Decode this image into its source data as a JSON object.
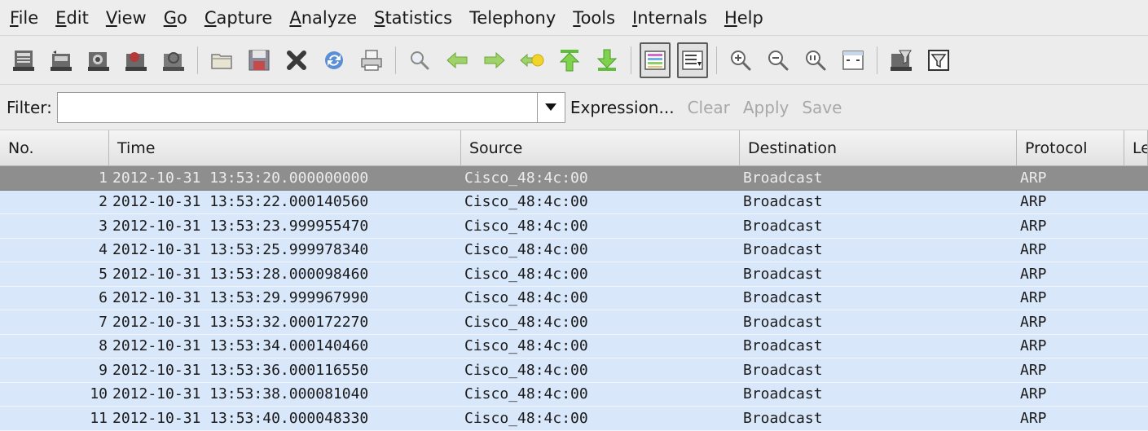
{
  "menu": [
    {
      "acc": "F",
      "rest": "ile"
    },
    {
      "acc": "E",
      "rest": "dit"
    },
    {
      "acc": "V",
      "rest": "iew"
    },
    {
      "acc": "G",
      "rest": "o"
    },
    {
      "acc": "C",
      "rest": "apture"
    },
    {
      "acc": "A",
      "rest": "nalyze"
    },
    {
      "acc": "S",
      "rest": "tatistics"
    },
    {
      "acc": "",
      "rest": "Telephony"
    },
    {
      "acc": "T",
      "rest": "ools"
    },
    {
      "acc": "I",
      "rest": "nternals"
    },
    {
      "acc": "H",
      "rest": "elp"
    }
  ],
  "filter": {
    "label": "Filter:",
    "value": "",
    "expression_label": "Expression...",
    "clear_label": "Clear",
    "apply_label": "Apply",
    "save_label": "Save"
  },
  "columns": {
    "no": "No.",
    "time": "Time",
    "source": "Source",
    "destination": "Destination",
    "protocol": "Protocol",
    "length": "Le"
  },
  "packets": [
    {
      "no": "1",
      "time": "2012-10-31  13:53:20.000000000",
      "source": "Cisco_48:4c:00",
      "destination": "Broadcast",
      "protocol": "ARP"
    },
    {
      "no": "2",
      "time": "2012-10-31  13:53:22.000140560",
      "source": "Cisco_48:4c:00",
      "destination": "Broadcast",
      "protocol": "ARP"
    },
    {
      "no": "3",
      "time": "2012-10-31  13:53:23.999955470",
      "source": "Cisco_48:4c:00",
      "destination": "Broadcast",
      "protocol": "ARP"
    },
    {
      "no": "4",
      "time": "2012-10-31  13:53:25.999978340",
      "source": "Cisco_48:4c:00",
      "destination": "Broadcast",
      "protocol": "ARP"
    },
    {
      "no": "5",
      "time": "2012-10-31  13:53:28.000098460",
      "source": "Cisco_48:4c:00",
      "destination": "Broadcast",
      "protocol": "ARP"
    },
    {
      "no": "6",
      "time": "2012-10-31  13:53:29.999967990",
      "source": "Cisco_48:4c:00",
      "destination": "Broadcast",
      "protocol": "ARP"
    },
    {
      "no": "7",
      "time": "2012-10-31  13:53:32.000172270",
      "source": "Cisco_48:4c:00",
      "destination": "Broadcast",
      "protocol": "ARP"
    },
    {
      "no": "8",
      "time": "2012-10-31  13:53:34.000140460",
      "source": "Cisco_48:4c:00",
      "destination": "Broadcast",
      "protocol": "ARP"
    },
    {
      "no": "9",
      "time": "2012-10-31  13:53:36.000116550",
      "source": "Cisco_48:4c:00",
      "destination": "Broadcast",
      "protocol": "ARP"
    },
    {
      "no": "10",
      "time": "2012-10-31  13:53:38.000081040",
      "source": "Cisco_48:4c:00",
      "destination": "Broadcast",
      "protocol": "ARP"
    },
    {
      "no": "11",
      "time": "2012-10-31  13:53:40.000048330",
      "source": "Cisco_48:4c:00",
      "destination": "Broadcast",
      "protocol": "ARP"
    }
  ],
  "toolbar_icons": [
    "interface-list-icon",
    "capture-options-icon",
    "start-capture-icon",
    "stop-capture-icon",
    "restart-capture-icon",
    "open-file-icon",
    "save-file-icon",
    "close-file-icon",
    "reload-file-icon",
    "print-icon",
    "find-packet-icon",
    "go-back-icon",
    "go-forward-icon",
    "go-to-packet-icon",
    "go-first-icon",
    "go-last-icon",
    "colorize-icon",
    "auto-scroll-icon",
    "zoom-in-icon",
    "zoom-out-icon",
    "normal-size-icon",
    "resize-columns-icon",
    "capture-filters-icon",
    "display-filters-icon"
  ],
  "colors": {
    "row_bg": "#d9e7fb",
    "selected_row_bg": "#8e8e8e"
  }
}
